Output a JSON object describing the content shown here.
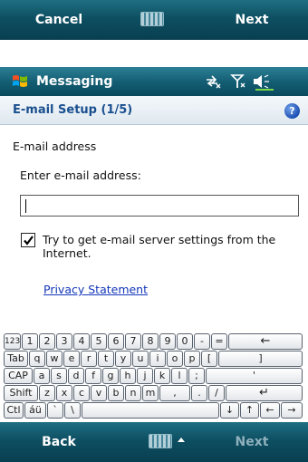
{
  "top_softkeys": {
    "left": "Cancel",
    "right": "Next"
  },
  "titlebar": {
    "title": "Messaging",
    "icons": [
      "windows-flag-icon",
      "connectivity-icon",
      "signal-off-icon",
      "speaker-icon"
    ]
  },
  "header": {
    "title": "E-mail Setup (1/5)",
    "help_glyph": "?"
  },
  "form": {
    "section_label": "E-mail address",
    "prompt": "Enter e-mail address:",
    "email_value": "",
    "checkbox_checked": true,
    "checkbox_label": "Try to get e-mail server settings from the Internet.",
    "privacy_link": "Privacy Statement"
  },
  "keyboard": {
    "rows": [
      [
        "123",
        "1",
        "2",
        "3",
        "4",
        "5",
        "6",
        "7",
        "8",
        "9",
        "0",
        "-",
        "=",
        "←"
      ],
      [
        "Tab",
        "q",
        "w",
        "e",
        "r",
        "t",
        "y",
        "u",
        "i",
        "o",
        "p",
        "[",
        "]"
      ],
      [
        "CAP",
        "a",
        "s",
        "d",
        "f",
        "g",
        "h",
        "j",
        "k",
        "l",
        ";",
        "'"
      ],
      [
        "Shift",
        "z",
        "x",
        "c",
        "v",
        "b",
        "n",
        "m",
        ",",
        ".",
        "/",
        "↵"
      ],
      [
        "Ctl",
        "áü",
        "`",
        "\\",
        " ",
        "↓",
        "↑",
        "←",
        "→"
      ]
    ]
  },
  "bottom_softkeys": {
    "left": "Back",
    "right": "Next"
  },
  "colors": {
    "bar": "#0e4f62",
    "link": "#1336b8",
    "header_text": "#1a4f8f"
  }
}
